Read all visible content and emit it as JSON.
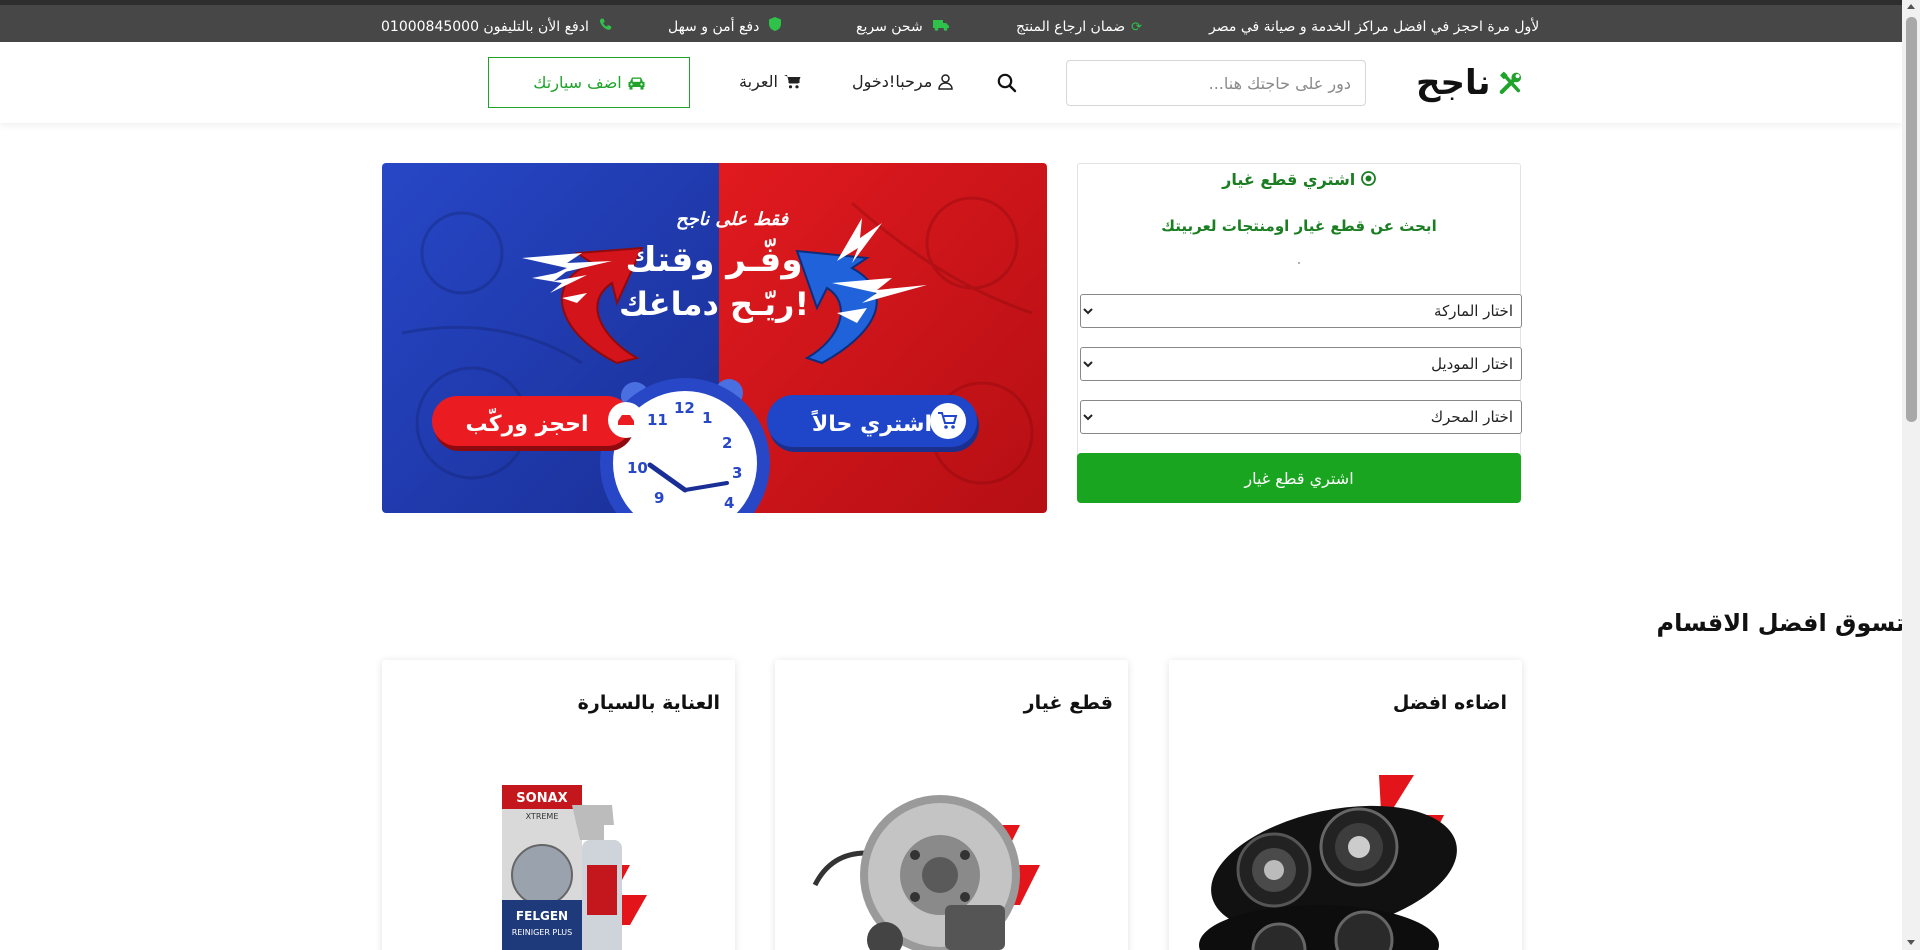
{
  "topbar": {
    "items": [
      {
        "text": "لأول مرة احجز في افضل مراكز الخدمة و صيانة في مصر",
        "icon": "none"
      },
      {
        "text": "ضمان ارجاع المنتج",
        "icon": "refresh-icon"
      },
      {
        "text": "شحن سريع",
        "icon": "truck-icon"
      },
      {
        "text": "دفع أمن و سهل",
        "icon": "shield-icon"
      },
      {
        "text": "ادفع الأن بالتليفون 01000845000",
        "icon": "phone-icon"
      }
    ]
  },
  "header": {
    "logo_text": "ناجح",
    "search_placeholder": "دور على حاجتك هنا...",
    "login_label": "مرحبا!دخول",
    "cart_label": "العربة",
    "add_car_label": "اضف سيارتك"
  },
  "banner": {
    "top_text": "فقط على ناجح",
    "line1": "وفّـر وقتك",
    "line2": "ريّـح دماغك!",
    "buy_now": "اشتري حالاً",
    "book_install": "احجز وركّب",
    "clock_numbers": [
      "12",
      "1",
      "2",
      "3",
      "4",
      "9",
      "10",
      "11"
    ]
  },
  "parts_panel": {
    "title": "اشتري قطع غيار",
    "subtitle": "ابحث عن قطع غيار اومنتجات لعربيتك",
    "brand_select": "اختار الماركة",
    "model_select": "اختار الموديل",
    "engine_select": "اختار المحرك",
    "buy_button": "اشتري قطع غيار"
  },
  "categories": {
    "title": "تسوق افضل الاقسام",
    "cards": [
      {
        "title": "اضاءه افضل",
        "image": "headlight-image"
      },
      {
        "title": "قطع غيار",
        "image": "brake-disc-image"
      },
      {
        "title": "العناية بالسيارة",
        "image": "sonax-cleaner-image",
        "product_text": [
          "SONAX",
          "XTREME",
          "FELGEN",
          "REINIGER PLUS"
        ]
      }
    ]
  },
  "colors": {
    "accent_green": "#19a51f",
    "dark_green": "#1b7e22",
    "topbar_bg": "#474747",
    "banner_red": "#d4141b",
    "banner_blue": "#1f3fb5"
  }
}
